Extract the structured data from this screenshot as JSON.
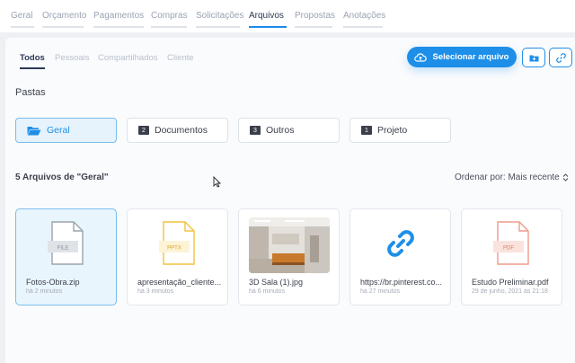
{
  "top_tabs": [
    "Geral",
    "Orçamento",
    "Pagamentos",
    "Compras",
    "Solicitações",
    "Arquivos",
    "Propostas",
    "Anotações"
  ],
  "sub_tabs": [
    "Todos",
    "Pessoais",
    "Compartilhados",
    "Cliente"
  ],
  "upload_button": "Selecionar arquivo",
  "folders_title": "Pastas",
  "folders": [
    {
      "label": "Geral",
      "count": ""
    },
    {
      "label": "Documentos",
      "count": "2"
    },
    {
      "label": "Outros",
      "count": "3"
    },
    {
      "label": "Projeto",
      "count": "1"
    }
  ],
  "files_title": "5 Arquivos de \"Geral\"",
  "sort_label": "Ordenar por: Mais recente",
  "files": [
    {
      "name": "Fotos-Obra.zip",
      "meta": "há 2 minutos",
      "type": "FILE"
    },
    {
      "name": "apresentação_cliente...",
      "meta": "há 3 minutos",
      "type": "PPTX"
    },
    {
      "name": "3D Sala (1).jpg",
      "meta": "há 6 minutos",
      "type": "image"
    },
    {
      "name": "https://br.pinterest.co...",
      "meta": "há 27 minutos",
      "type": "link"
    },
    {
      "name": "Estudo Preliminar.pdf",
      "meta": "29 de junho, 2021 às 21:18",
      "type": "PDF"
    }
  ],
  "colors": {
    "accent": "#1e8fe8",
    "pptx": "#f2c13b",
    "pdf": "#ef9b8b",
    "file": "#9aa3ad"
  }
}
